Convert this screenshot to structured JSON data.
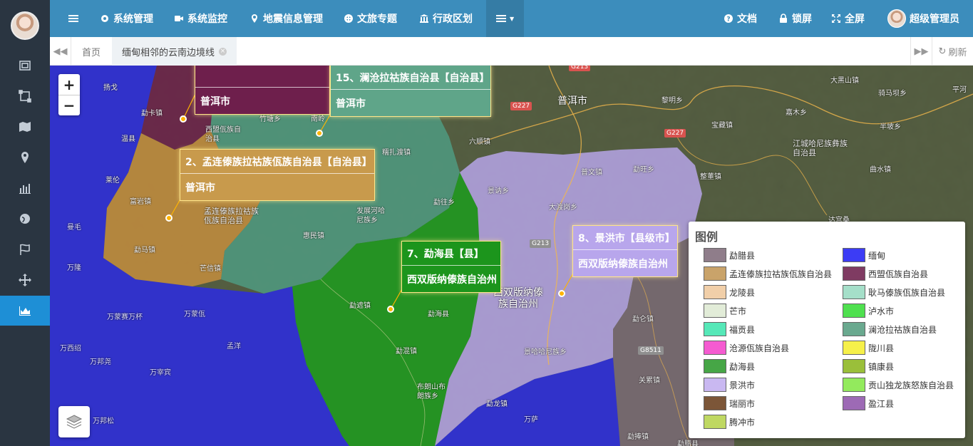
{
  "topbar": {
    "menu": [
      "系统管理",
      "系统监控",
      "地震信息管理",
      "文旅专题",
      "行政区划"
    ],
    "docs": "文档",
    "lock": "锁屏",
    "fullscreen": "全屏",
    "user": "超级管理员"
  },
  "tabs": {
    "home": "首页",
    "active": "缅甸相邻的云南边境线",
    "refresh": "刷新"
  },
  "sidebar": {
    "icons": [
      "frame-icon",
      "crop-icon",
      "map-icon",
      "marker-icon",
      "bar-chart-icon",
      "globe-icon",
      "flag-icon",
      "move-icon",
      "area-chart-icon"
    ]
  },
  "map": {
    "zoom_in": "+",
    "zoom_out": "−",
    "places": [
      "扬戈",
      "勐卡镇",
      "温县",
      "西盟佤族自治县",
      "竹塘乡",
      "南岭",
      "糯扎渡镇",
      "莱伦",
      "富岩镇",
      "孟连傣族拉祜族佤族自治县",
      "发展河哈尼族乡",
      "惠民镇",
      "勐马镇",
      "芒信镇",
      "曼毛",
      "万隆",
      "勐往乡",
      "勐遮镇",
      "勐海县",
      "勐混镇",
      "布朗山布朗族乡",
      "万蒙赛万杯",
      "万蒙佤",
      "万西绍",
      "万邦尧",
      "孟洋",
      "万宰宾",
      "万邦松",
      "万萨",
      "勐龙镇",
      "景讷乡",
      "大渡岗乡",
      "西双版纳傣族自治州",
      "景哈哈尼族乡",
      "普文镇",
      "勐旺乡",
      "六顺镇",
      "普洱市",
      "黎明乡",
      "宝藏镇",
      "嘉木乡",
      "江城哈尼族彝族自治县",
      "大黑山镇",
      "骑马坝乡",
      "半坡乡",
      "曲水镇",
      "整董镇",
      "达宫桑",
      "勐仑镇",
      "关累镇",
      "勐捧镇",
      "勐腊县",
      "平河"
    ],
    "roads": [
      "G213",
      "G227",
      "G227",
      "G213",
      "G8511"
    ]
  },
  "callouts": [
    {
      "title": "15、澜沧拉祜族自治县【自治县】",
      "sub": "普洱市",
      "color": "#5fa589"
    },
    {
      "title": "",
      "sub": "普洱市",
      "color": "#7b2352"
    },
    {
      "title": "2、孟连傣族拉祜族佤族自治县【自治县】",
      "sub": "普洱市",
      "color": "#c89a4c"
    },
    {
      "title": "7、勐海县【县】",
      "sub": "西双版纳傣族自治州",
      "color": "#1c951c"
    },
    {
      "title": "8、景洪市【县级市】",
      "sub": "西双版纳傣族自治州",
      "color": "#b8a6ec"
    }
  ],
  "legend": {
    "title": "图例",
    "items": [
      {
        "label": "勐腊县",
        "color": "#8f7d8a"
      },
      {
        "label": "缅甸",
        "color": "#3c3cf5"
      },
      {
        "label": "孟连傣族拉祜族佤族自治县",
        "color": "#c9a36a"
      },
      {
        "label": "西盟佤族自治县",
        "color": "#7f3b62"
      },
      {
        "label": "龙陵县",
        "color": "#f1cfa9"
      },
      {
        "label": "耿马傣族佤族自治县",
        "color": "#a5dfc9"
      },
      {
        "label": "芒市",
        "color": "#e2ecd8"
      },
      {
        "label": "泸水市",
        "color": "#4fe04f"
      },
      {
        "label": "福贡县",
        "color": "#56e8b8"
      },
      {
        "label": "澜沧拉祜族自治县",
        "color": "#6aa98f"
      },
      {
        "label": "沧源佤族自治县",
        "color": "#f55bd1"
      },
      {
        "label": "陇川县",
        "color": "#f6f04a"
      },
      {
        "label": "勐海县",
        "color": "#46a646"
      },
      {
        "label": "镇康县",
        "color": "#9abf3a"
      },
      {
        "label": "景洪市",
        "color": "#c9b8f1"
      },
      {
        "label": "贡山独龙族怒族自治县",
        "color": "#93ea5d"
      },
      {
        "label": "瑞丽市",
        "color": "#7c5638"
      },
      {
        "label": "盈江县",
        "color": "#9d6ab5"
      },
      {
        "label": "腾冲市",
        "color": "#bfd862"
      }
    ]
  }
}
